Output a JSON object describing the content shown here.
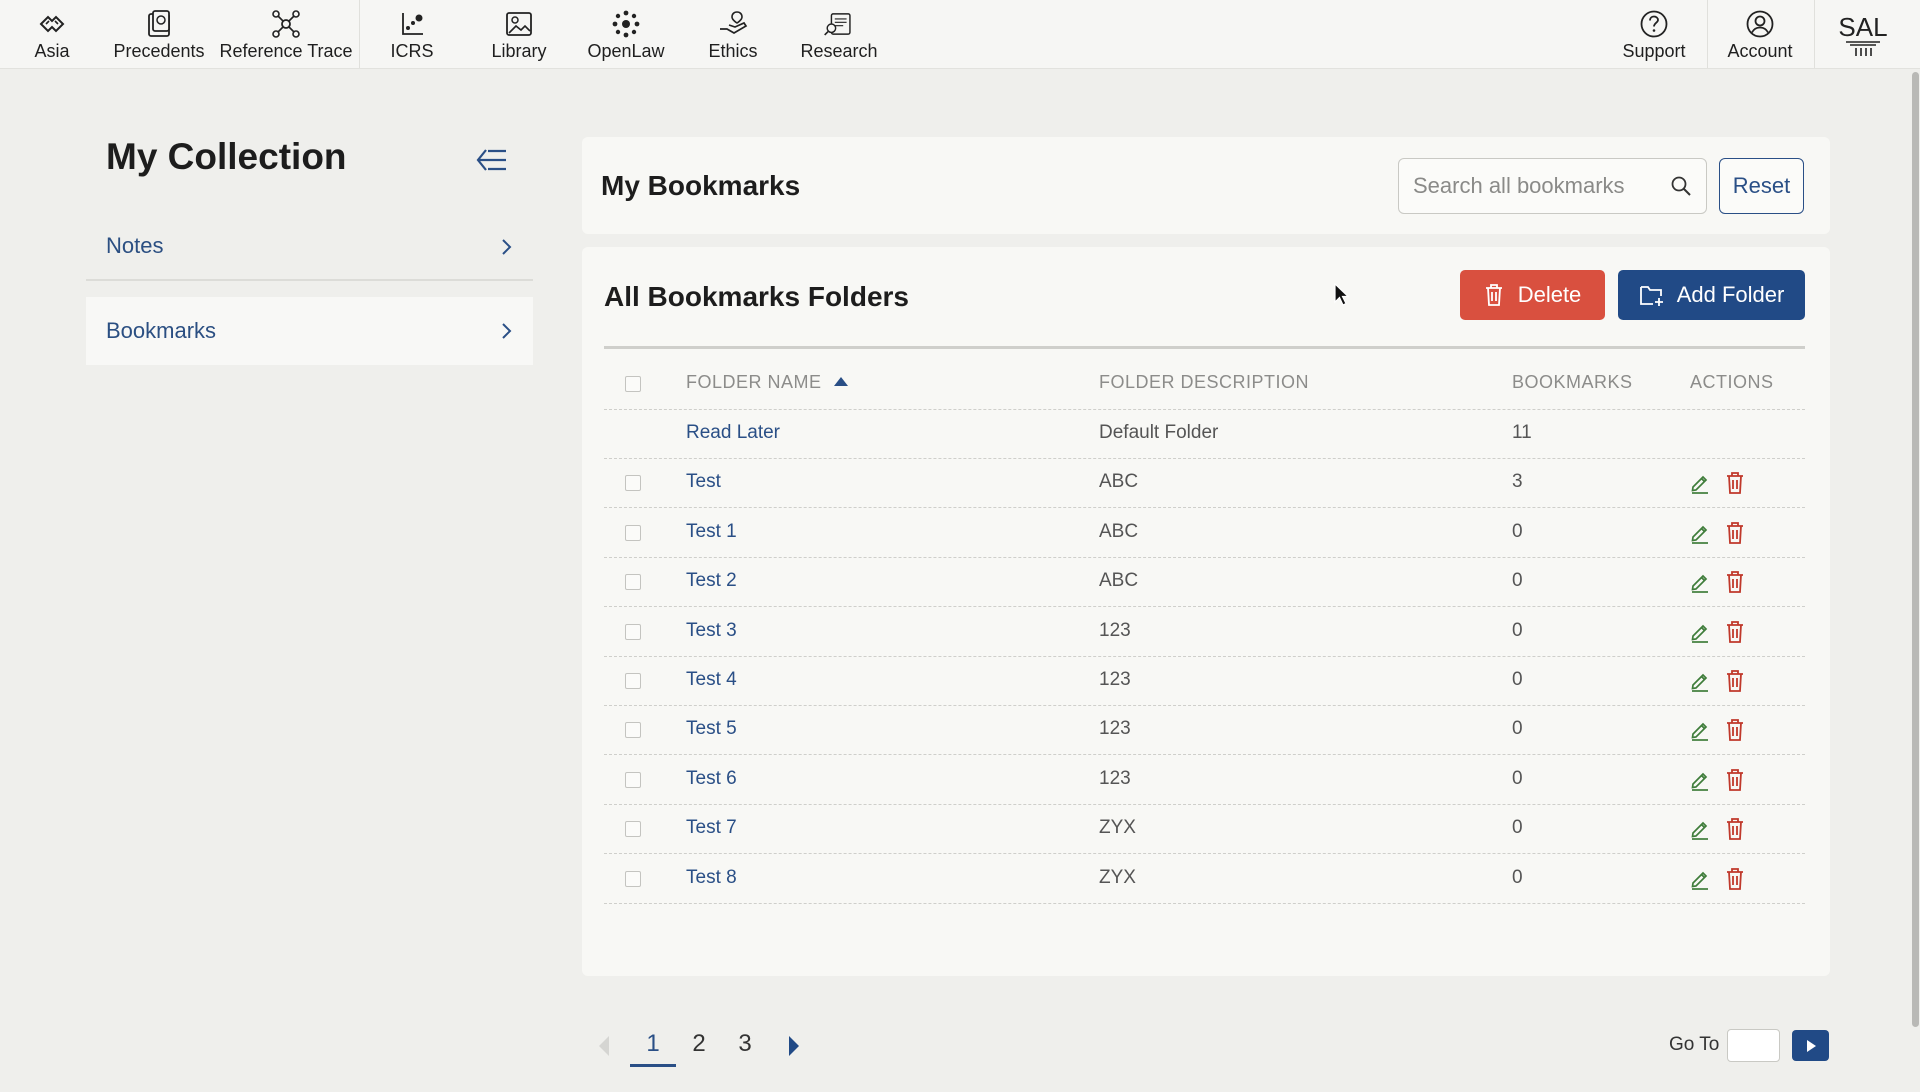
{
  "nav": {
    "items": [
      {
        "label": "Asia",
        "icon": "asia-logo-icon"
      },
      {
        "label": "Precedents",
        "icon": "precedents-icon"
      },
      {
        "label": "Reference Trace",
        "icon": "reference-trace-icon"
      },
      {
        "label": "ICRS",
        "icon": "icrs-icon"
      },
      {
        "label": "Library",
        "icon": "library-icon"
      },
      {
        "label": "OpenLaw",
        "icon": "openlaw-icon"
      },
      {
        "label": "Ethics",
        "icon": "ethics-icon"
      },
      {
        "label": "Research",
        "icon": "research-icon"
      }
    ],
    "right_items": [
      {
        "label": "Support",
        "icon": "help-circle-icon"
      },
      {
        "label": "Account",
        "icon": "account-icon"
      }
    ],
    "logo_text": "SAL"
  },
  "sidebar": {
    "title": "My Collection",
    "items": [
      {
        "label": "Notes",
        "active": false
      },
      {
        "label": "Bookmarks",
        "active": true
      }
    ]
  },
  "header": {
    "title": "My Bookmarks",
    "search_placeholder": "Search all bookmarks",
    "search_value": "",
    "reset_label": "Reset"
  },
  "folders": {
    "title": "All Bookmarks Folders",
    "delete_label": "Delete",
    "add_label": "Add Folder",
    "columns": [
      "FOLDER NAME",
      "FOLDER DESCRIPTION",
      "BOOKMARKS",
      "ACTIONS"
    ],
    "sort": {
      "column": "FOLDER NAME",
      "direction": "ascending"
    },
    "rows": [
      {
        "name": "Read Later",
        "description": "Default Folder",
        "bookmarks": "11",
        "default": true
      },
      {
        "name": "Test",
        "description": "ABC",
        "bookmarks": "3",
        "default": false
      },
      {
        "name": "Test 1",
        "description": "ABC",
        "bookmarks": "0",
        "default": false
      },
      {
        "name": "Test 2",
        "description": "ABC",
        "bookmarks": "0",
        "default": false
      },
      {
        "name": "Test 3",
        "description": "123",
        "bookmarks": "0",
        "default": false
      },
      {
        "name": "Test 4",
        "description": "123",
        "bookmarks": "0",
        "default": false
      },
      {
        "name": "Test 5",
        "description": "123",
        "bookmarks": "0",
        "default": false
      },
      {
        "name": "Test 6",
        "description": "123",
        "bookmarks": "0",
        "default": false
      },
      {
        "name": "Test 7",
        "description": "ZYX",
        "bookmarks": "0",
        "default": false
      },
      {
        "name": "Test 8",
        "description": "ZYX",
        "bookmarks": "0",
        "default": false
      }
    ]
  },
  "pagination": {
    "pages": [
      "1",
      "2",
      "3"
    ],
    "current": "1",
    "goto_label": "Go To",
    "goto_value": ""
  },
  "colors": {
    "primary": "#214a86",
    "link": "#2a4f86",
    "danger": "#d9503f",
    "edit_icon": "#3f7d3a",
    "delete_icon": "#c0392b"
  }
}
